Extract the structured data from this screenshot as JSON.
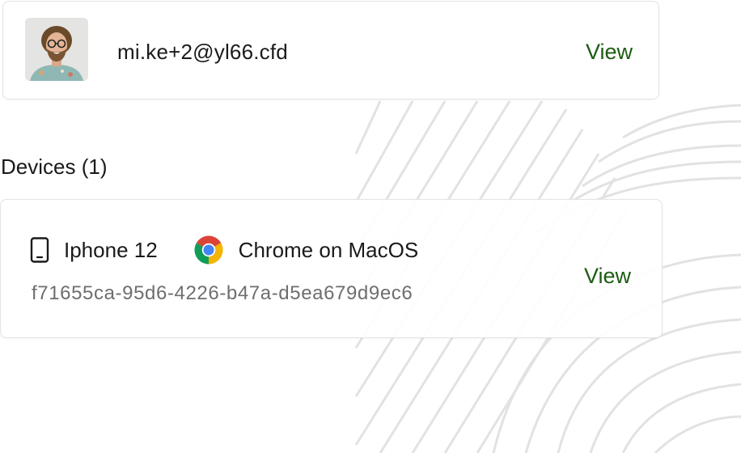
{
  "user": {
    "email": "mi.ke+2@yl66.cfd",
    "view_label": "View",
    "avatar_icon": "user-avatar-photo"
  },
  "devices": {
    "title": "Devices (1)",
    "items": [
      {
        "name": "Iphone 12",
        "browser": "Chrome on MacOS",
        "id": "f71655ca-95d6-4226-b47a-d5ea679d9ec6",
        "view_label": "View",
        "device_icon": "phone-icon",
        "browser_icon": "chrome-icon"
      }
    ]
  },
  "colors": {
    "link": "#1c5c12",
    "secondary_text": "#6e6e6e",
    "card_border": "#e3e3e3"
  }
}
